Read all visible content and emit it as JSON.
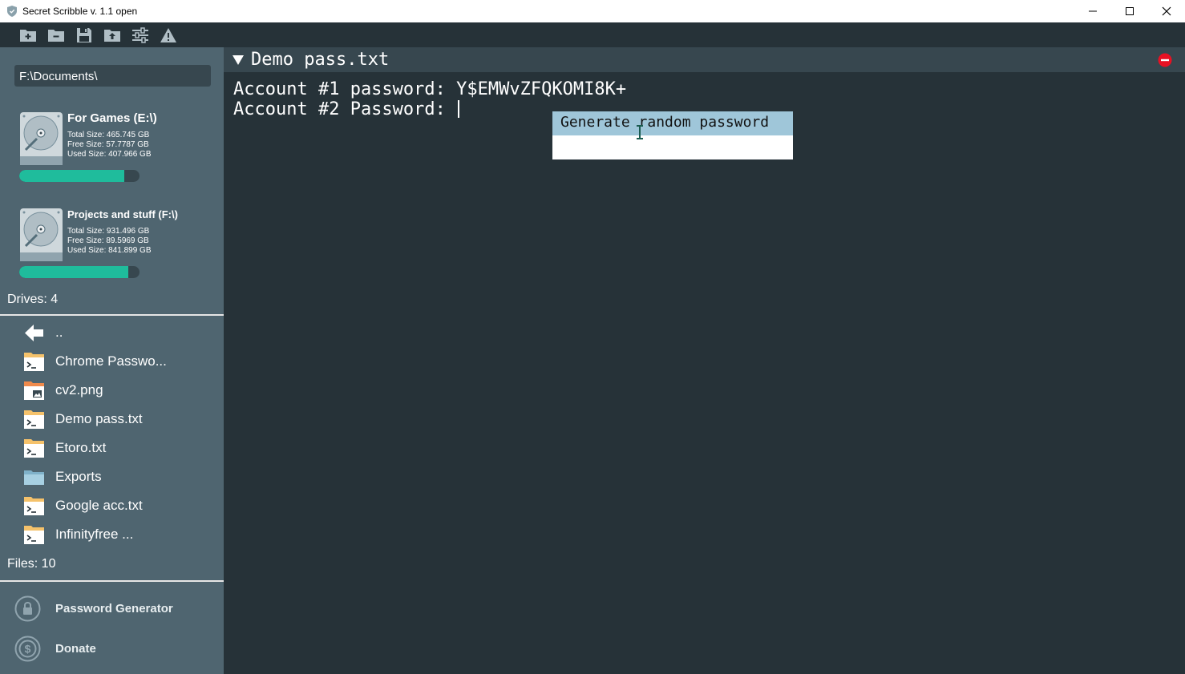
{
  "window": {
    "title": "Secret Scribble v. 1.1 open",
    "controls": {
      "minimize": "—",
      "maximize": "☐",
      "close": "✕"
    }
  },
  "toolbar": {
    "buttons": [
      "new-folder-icon",
      "remove-folder-icon",
      "save-icon",
      "export-icon",
      "settings-icon",
      "warning-icon"
    ]
  },
  "sidebar": {
    "path": "F:\\Documents\\",
    "drives": [
      {
        "name": "For Games (E:\\)",
        "total": "Total Size: 465.745 GB",
        "free": "Free Size: 57.7787 GB",
        "used": "Used Size: 407.966 GB",
        "used_fraction": 0.876
      },
      {
        "name": "Projects and stuff (F:\\)",
        "total": "Total Size: 931.496 GB",
        "free": "Free Size: 89.5969 GB",
        "used": "Used Size: 841.899 GB",
        "used_fraction": 0.904
      }
    ],
    "drives_count": "Drives: 4",
    "files": [
      {
        "name": "..",
        "icon": "back-arrow-icon"
      },
      {
        "name": "Chrome Passwo...",
        "icon": "text-file-icon"
      },
      {
        "name": "cv2.png",
        "icon": "image-file-icon"
      },
      {
        "name": "Demo pass.txt",
        "icon": "text-file-icon"
      },
      {
        "name": "Etoro.txt",
        "icon": "text-file-icon"
      },
      {
        "name": "Exports",
        "icon": "folder-icon"
      },
      {
        "name": "Google acc.txt",
        "icon": "text-file-icon"
      },
      {
        "name": "Infinityfree ...",
        "icon": "text-file-icon"
      }
    ],
    "files_count": "Files: 10",
    "bottom": {
      "password_generator": "Password Generator",
      "donate": "Donate"
    }
  },
  "editor": {
    "tab_title": "Demo pass.txt",
    "line1": "Account #1 password: Y$EMWvZFQKOMI8K+",
    "line2": "Account #2 Password: ",
    "popup_item": "Generate random password"
  },
  "colors": {
    "sidebar_bg": "#4f6570",
    "editor_bg": "#263238",
    "tab_bg": "#37474f",
    "accent_green": "#1fbc9c",
    "popup_highlight": "#9fc6d9",
    "close_red": "#e81123"
  }
}
